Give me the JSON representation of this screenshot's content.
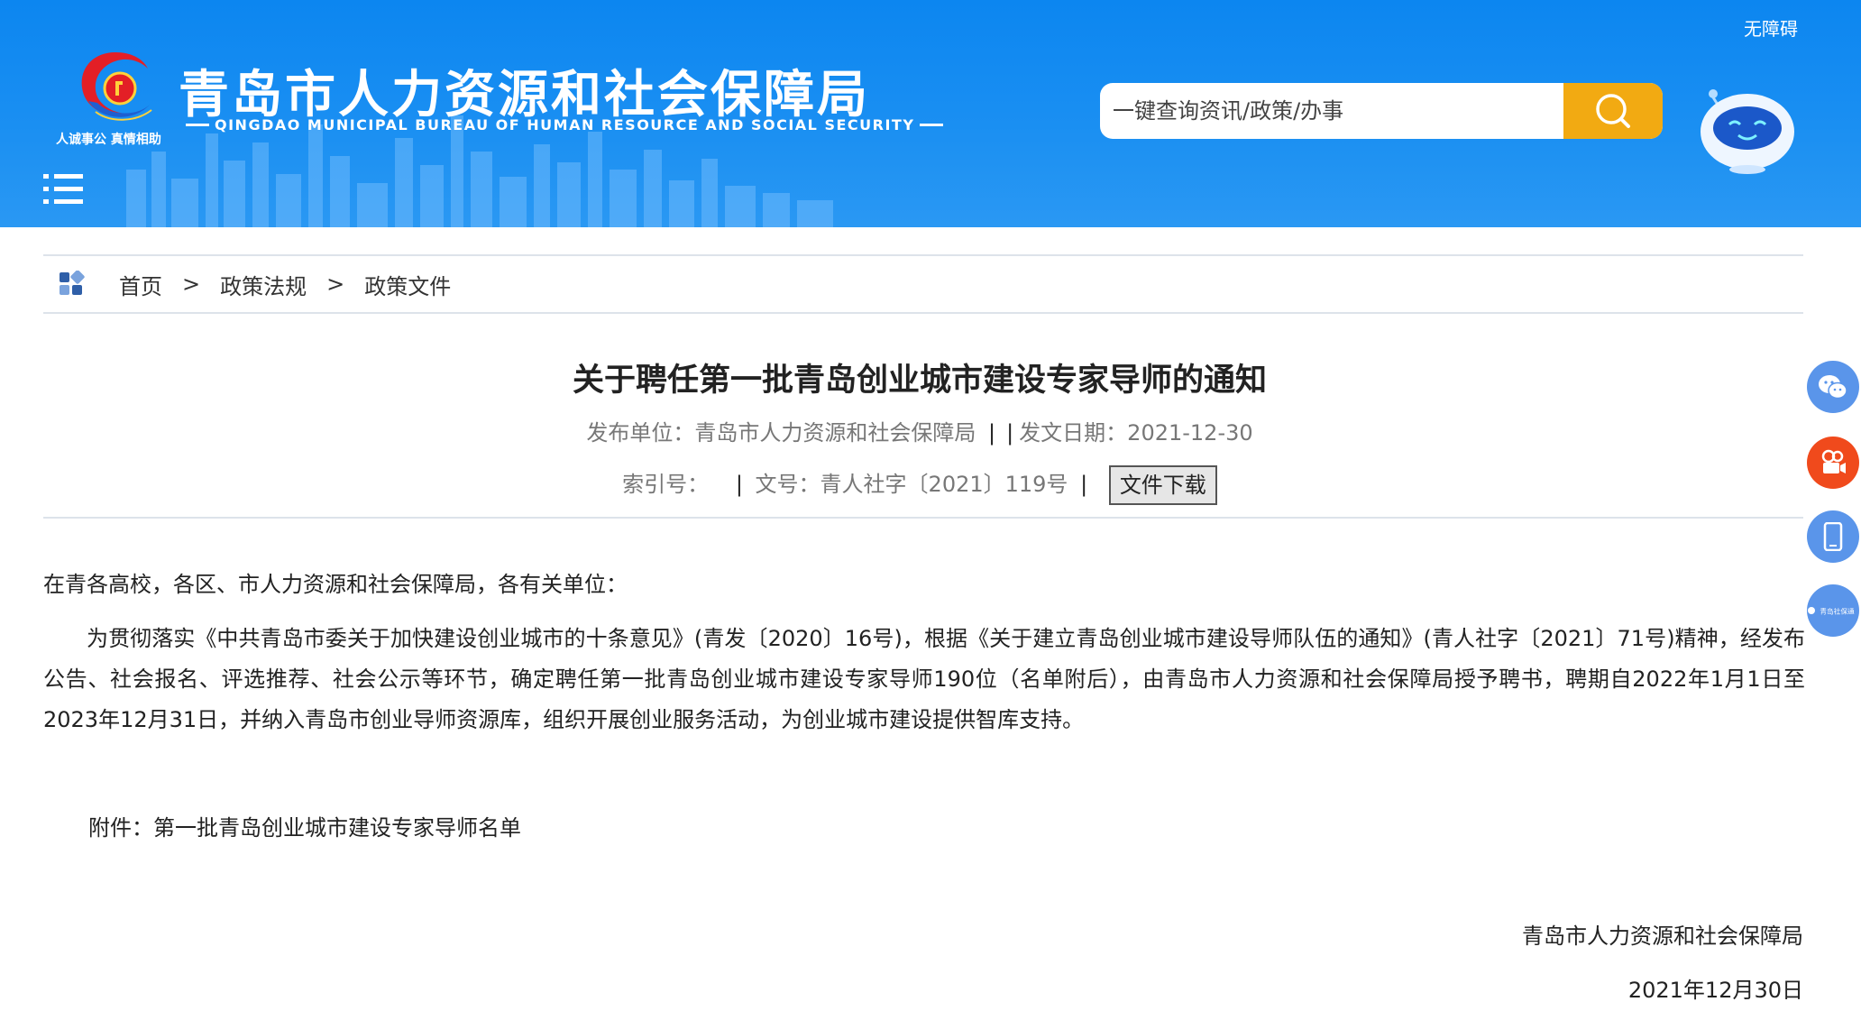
{
  "header": {
    "title": "青岛市人力资源和社会保障局",
    "subtitle": "QINGDAO MUNICIPAL BUREAU OF HUMAN RESOURCE AND SOCIAL SECURITY",
    "motto": "人诚事公  真情相助",
    "accessibility_label": "无障碍",
    "search_placeholder": "一键查询资讯/政策/办事",
    "brand_color": "#1a8ff2",
    "search_button_color": "#f2aa12"
  },
  "breadcrumb": {
    "items": [
      "首页",
      "政策法规",
      "政策文件"
    ],
    "separator": ">"
  },
  "article": {
    "title": "关于聘任第一批青岛创业城市建设专家导师的通知",
    "publisher_label": "发布单位：",
    "publisher": "青岛市人力资源和社会保障局",
    "date_label": "发文日期：",
    "date": "2021-12-30",
    "index_label": "索引号：",
    "index_value": "",
    "doc_no_label": "文号：",
    "doc_no": "青人社字〔2021〕119号",
    "download_label": "文件下载",
    "salutation": "在青各高校，各区、市人力资源和社会保障局，各有关单位：",
    "paragraph": "为贯彻落实《中共青岛市委关于加快建设创业城市的十条意见》(青发〔2020〕16号)，根据《关于建立青岛创业城市建设导师队伍的通知》(青人社字〔2021〕71号)精神，经发布公告、社会报名、评选推荐、社会公示等环节，确定聘任第一批青岛创业城市建设专家导师190位（名单附后），由青岛市人力资源和社会保障局授予聘书，聘期自2022年1月1日至2023年12月31日，并纳入青岛市创业导师资源库，组织开展创业服务活动，为创业城市建设提供智库支持。",
    "attachment": "附件：第一批青岛创业城市建设专家导师名单",
    "signer": "青岛市人力资源和社会保障局",
    "sign_date": "2021年12月30日"
  },
  "side_buttons": {
    "icons": [
      "wechat-icon",
      "video-icon",
      "mobile-icon",
      "app-icon"
    ],
    "app_text": "青岛社保通"
  }
}
